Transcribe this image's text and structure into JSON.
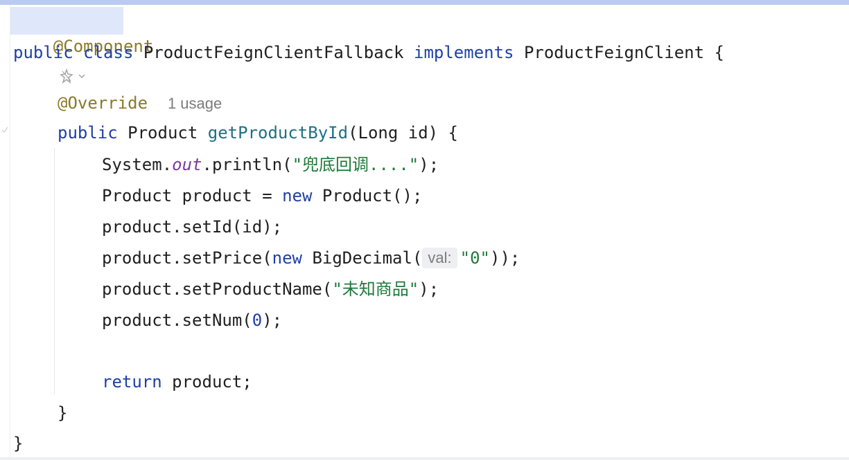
{
  "code": {
    "line1": {
      "annotation": "@Component"
    },
    "line2": {
      "kw1": "public",
      "kw2": "class",
      "class_name": "ProductFeignClientFallback",
      "kw3": "implements",
      "iface": "ProductFeignClient",
      "brace": "{"
    },
    "line4": {
      "annotation": "@Override",
      "usages": "1 usage"
    },
    "line5": {
      "kw": "public",
      "type": "Product",
      "method": "getProductById",
      "params_open": "(Long id) {"
    },
    "line6": {
      "prefix": "System.",
      "field": "out",
      "mid": ".println(",
      "string": "\"兜底回调....\"",
      "end": ");"
    },
    "line7": {
      "prefix": "Product product = ",
      "kw": "new",
      "suffix": " Product();"
    },
    "line8": {
      "text": "product.setId(id);"
    },
    "line9": {
      "prefix": "product.setPrice(",
      "kw": "new",
      "mid": " BigDecimal(",
      "hint": "val:",
      "string": "\"0\"",
      "end": "));"
    },
    "line10": {
      "prefix": "product.setProductName(",
      "string": "\"未知商品\"",
      "end": ");"
    },
    "line11": {
      "prefix": "product.setNum(",
      "num": "0",
      "end": ");"
    },
    "line13": {
      "kw": "return",
      "suffix": " product;"
    },
    "line14": {
      "brace": "}"
    },
    "line15": {
      "brace": "}"
    }
  },
  "icons": {
    "gutter": "ai-assistant-icon",
    "dropdown": "chevron-down-icon"
  },
  "colors": {
    "keyword": "#1f3fa8",
    "annotation": "#8a7a2a",
    "string": "#1e7a3b",
    "method": "#1f6f84",
    "static_field": "#7a3aa0",
    "selection": "#dfe8fb"
  }
}
